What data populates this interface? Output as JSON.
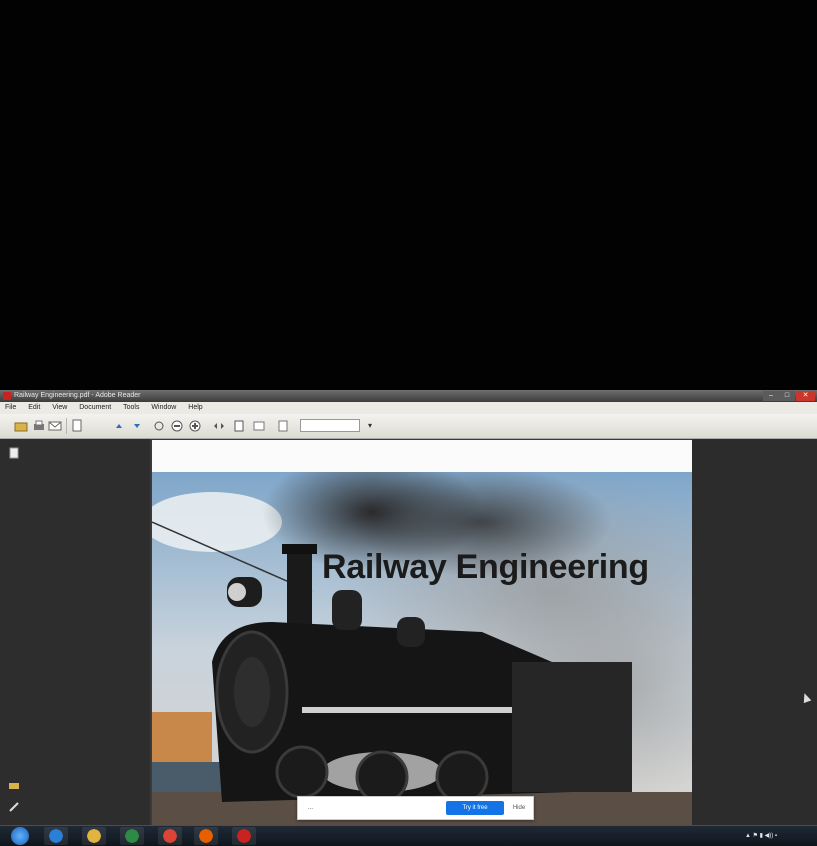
{
  "window": {
    "title": "Railway Engineering.pdf - Adobe Reader",
    "min_label": "–",
    "max_label": "□",
    "close_label": "✕"
  },
  "menu": {
    "items": [
      "File",
      "Edit",
      "View",
      "Document",
      "Tools",
      "Window",
      "Help"
    ]
  },
  "toolbar": {
    "page_value": "",
    "zoom_arrow": "▾"
  },
  "document": {
    "slide_title": "Railway Engineering"
  },
  "notice": {
    "message": "...",
    "primary_label": "Try it free",
    "secondary_label": "Hide"
  },
  "taskbar": {
    "apps": [
      {
        "icon": "internet-explorer-icon",
        "color": "#2a7fd6"
      },
      {
        "icon": "file-explorer-icon",
        "color": "#e1b43f"
      },
      {
        "icon": "excel-icon",
        "color": "#2e8b45"
      },
      {
        "icon": "chrome-icon",
        "color": "#db4437"
      },
      {
        "icon": "firefox-icon",
        "color": "#e66000"
      },
      {
        "icon": "adobe-reader-icon",
        "color": "#c8231f"
      }
    ],
    "clock_time": "",
    "clock_date": ""
  },
  "colors": {
    "notice_button": "#1473e6",
    "reader_red": "#c8231f"
  }
}
